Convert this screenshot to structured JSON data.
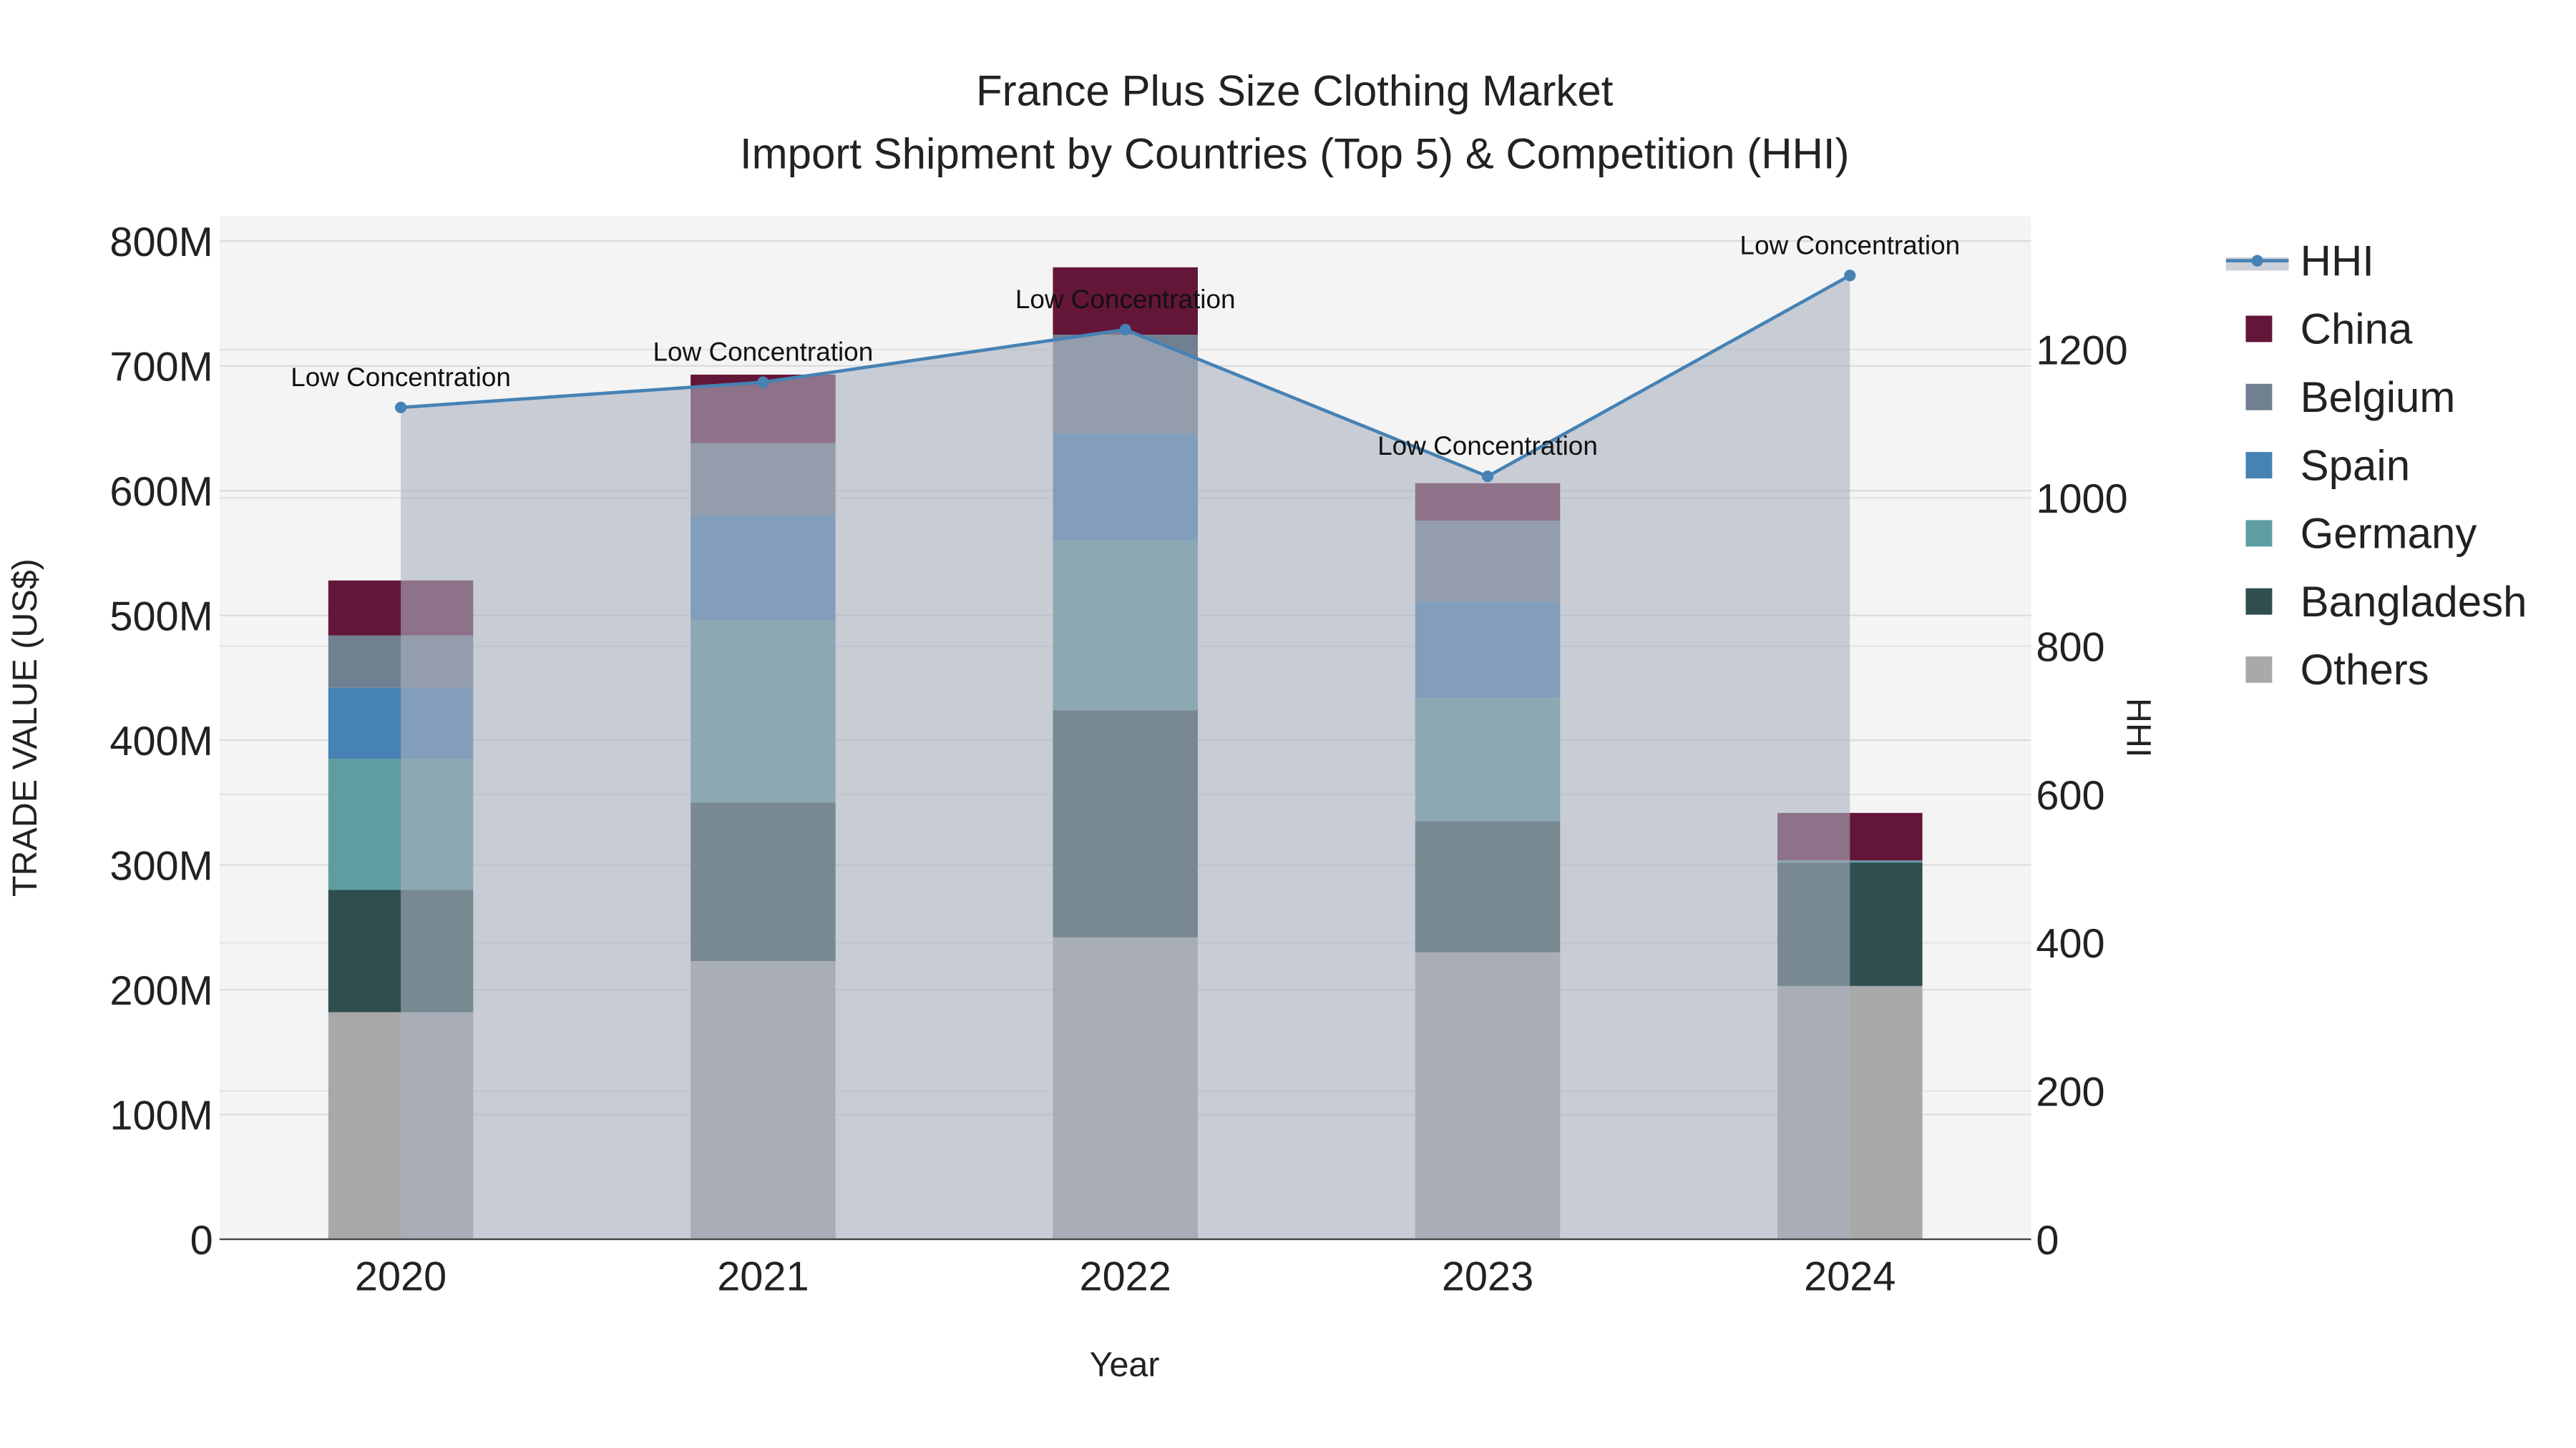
{
  "chart_data": {
    "type": "bar",
    "title": "France Plus Size Clothing Market",
    "subtitle": "Import Shipment by Countries (Top 5) & Competition (HHI)",
    "xlabel": "Year",
    "ylabel": "TRADE VALUE (US$)",
    "y2label": "HHI",
    "categories": [
      "2020",
      "2021",
      "2022",
      "2023",
      "2024"
    ],
    "stacked": true,
    "ylim": [
      0,
      820
    ],
    "y_ticks": [
      0,
      100,
      200,
      300,
      400,
      500,
      600,
      700,
      800
    ],
    "y_tick_labels": [
      "0",
      "100M",
      "200M",
      "300M",
      "400M",
      "500M",
      "600M",
      "700M",
      "800M"
    ],
    "y2lim": [
      0,
      1380
    ],
    "y2_ticks": [
      0,
      200,
      400,
      600,
      800,
      1000,
      1200
    ],
    "y2_tick_labels": [
      "0",
      "200",
      "400",
      "600",
      "800",
      "1000",
      "1200"
    ],
    "units": "million US$",
    "series": [
      {
        "name": "Others",
        "color": "#A9A9A9",
        "values": [
          182,
          223,
          242,
          230,
          203
        ]
      },
      {
        "name": "Bangladesh",
        "color": "#2F4F4F",
        "values": [
          98,
          127,
          182,
          105,
          99
        ]
      },
      {
        "name": "Germany",
        "color": "#5F9EA0",
        "values": [
          105,
          146,
          136,
          99,
          0.8
        ]
      },
      {
        "name": "Spain",
        "color": "#4682B4",
        "values": [
          57,
          84,
          86,
          77,
          0.4
        ]
      },
      {
        "name": "Belgium",
        "color": "#708090",
        "values": [
          42,
          58,
          79,
          65,
          0.5
        ]
      },
      {
        "name": "China",
        "color": "#641638",
        "values": [
          44,
          55,
          54,
          30,
          38
        ]
      }
    ],
    "line": {
      "name": "HHI",
      "color": "#4682B4",
      "axis": "y2",
      "values": [
        1122,
        1156,
        1227,
        1029,
        1300
      ],
      "annotations": [
        "Low Concentration",
        "Low Concentration",
        "Low Concentration",
        "Low Concentration",
        "Low Concentration"
      ]
    },
    "legend": {
      "placement": "right",
      "entries": [
        "HHI",
        "China",
        "Belgium",
        "Spain",
        "Germany",
        "Bangladesh",
        "Others"
      ]
    },
    "grid": true
  }
}
